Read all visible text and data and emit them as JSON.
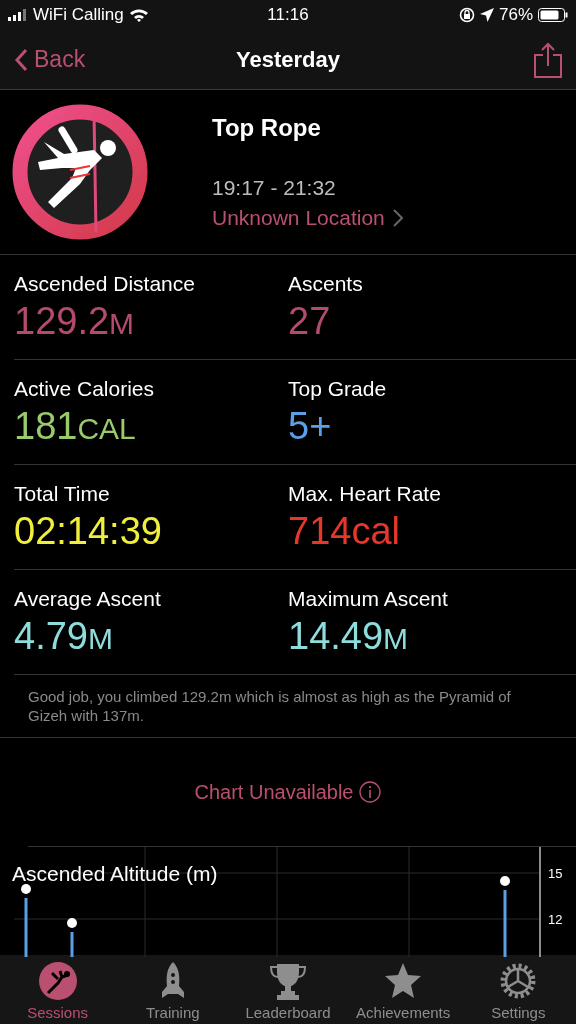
{
  "status_bar": {
    "carrier": "WiFi Calling",
    "time": "11:16",
    "battery": "76%"
  },
  "nav": {
    "back": "Back",
    "title": "Yesterday"
  },
  "session": {
    "title": "Top Rope",
    "time_range": "19:17 - 21:32",
    "location": "Unknown Location"
  },
  "stats": [
    {
      "label": "Ascended Distance",
      "value": "129.2",
      "unit": "M",
      "color": "#b44a6c"
    },
    {
      "label": "Ascents",
      "value": "27",
      "color": "#b44a6c"
    },
    {
      "label": "Active Calories",
      "value": "181",
      "unit": "CAL",
      "color": "#9acb6a"
    },
    {
      "label": "Top Grade",
      "value": "5+",
      "color": "#5aa0e6"
    },
    {
      "label": "Total Time",
      "value": "02:14:39",
      "color": "#f0f03c"
    },
    {
      "label": "Max. Heart Rate",
      "value": "714cal",
      "color": "#e5382a"
    },
    {
      "label": "Average Ascent",
      "value": "4.79",
      "unit": "M",
      "color": "#8edcdc"
    },
    {
      "label": "Maximum Ascent",
      "value": "14.49",
      "unit": "M",
      "color": "#8edcdc"
    }
  ],
  "message": "Good job, you climbed 129.2m which is almost as high as the Pyramid of Gizeh with 137m.",
  "chart_notice": "Chart Unavailable",
  "chart": {
    "title": "Ascended Altitude (m)",
    "tick_labels": [
      "15",
      "12"
    ]
  },
  "tabs": [
    {
      "label": "Sessions",
      "selected": true
    },
    {
      "label": "Training",
      "selected": false
    },
    {
      "label": "Leaderboard",
      "selected": false
    },
    {
      "label": "Achievements",
      "selected": false
    },
    {
      "label": "Settings",
      "selected": false
    }
  ]
}
